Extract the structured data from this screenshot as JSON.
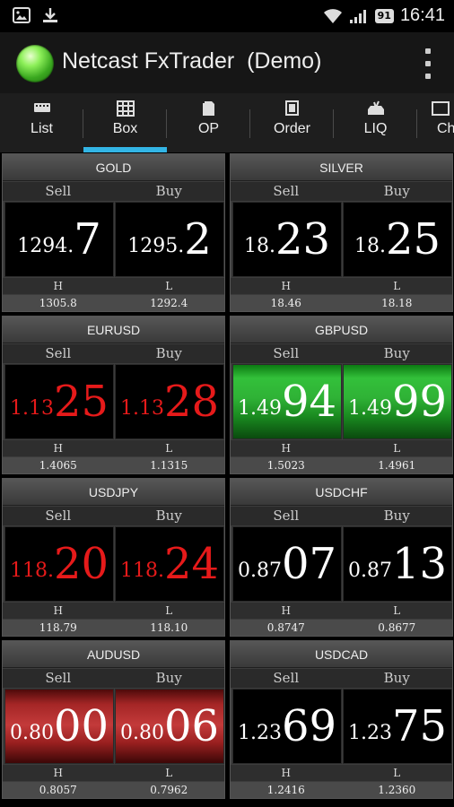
{
  "status_bar": {
    "time": "16:41",
    "battery": "91",
    "icons": [
      "image-icon",
      "download-icon",
      "wifi-icon",
      "signal-icon",
      "battery-icon"
    ]
  },
  "app": {
    "title": "Netcast FxTrader  (Demo)",
    "logo": "green-orb-logo",
    "overflow_icon": "more-vert-icon"
  },
  "tabs": [
    {
      "label": "List",
      "icon": "list-icon",
      "active": false
    },
    {
      "label": "Box",
      "icon": "grid-icon",
      "active": true
    },
    {
      "label": "OP",
      "icon": "document-icon",
      "active": false
    },
    {
      "label": "Order",
      "icon": "copy-icon",
      "active": false
    },
    {
      "label": "LIQ",
      "icon": "tray-icon",
      "active": false
    },
    {
      "label": "Ch",
      "icon": "chart-icon",
      "active": false
    }
  ],
  "colors": {
    "accent": "#33b5e5",
    "down": "#e61a1a",
    "up_bg": "#2fb236",
    "down_bg": "#c33a3a"
  },
  "quotes": [
    {
      "symbol": "GOLD",
      "sell_label": "Sell",
      "buy_label": "Buy",
      "sell": {
        "small": "1294.",
        "big": "7",
        "style": "white"
      },
      "buy": {
        "small": "1295.",
        "big": "2",
        "style": "white"
      },
      "hi_label": "H",
      "lo_label": "L",
      "high": "1305.8",
      "low": "1292.4"
    },
    {
      "symbol": "SILVER",
      "sell_label": "Sell",
      "buy_label": "Buy",
      "sell": {
        "small": "18.",
        "big": "23",
        "style": "white"
      },
      "buy": {
        "small": "18.",
        "big": "25",
        "style": "white"
      },
      "hi_label": "H",
      "lo_label": "L",
      "high": "18.46",
      "low": "18.18"
    },
    {
      "symbol": "EURUSD",
      "sell_label": "Sell",
      "buy_label": "Buy",
      "sell": {
        "small": "1.13",
        "big": "25",
        "style": "red"
      },
      "buy": {
        "small": "1.13",
        "big": "28",
        "style": "red"
      },
      "hi_label": "H",
      "lo_label": "L",
      "high": "1.4065",
      "low": "1.1315"
    },
    {
      "symbol": "GBPUSD",
      "sell_label": "Sell",
      "buy_label": "Buy",
      "sell": {
        "small": "1.49",
        "big": "94",
        "style": "green"
      },
      "buy": {
        "small": "1.49",
        "big": "99",
        "style": "green"
      },
      "hi_label": "H",
      "lo_label": "L",
      "high": "1.5023",
      "low": "1.4961"
    },
    {
      "symbol": "USDJPY",
      "sell_label": "Sell",
      "buy_label": "Buy",
      "sell": {
        "small": "118.",
        "big": "20",
        "style": "red"
      },
      "buy": {
        "small": "118.",
        "big": "24",
        "style": "red"
      },
      "hi_label": "H",
      "lo_label": "L",
      "high": "118.79",
      "low": "118.10"
    },
    {
      "symbol": "USDCHF",
      "sell_label": "Sell",
      "buy_label": "Buy",
      "sell": {
        "small": "0.87",
        "big": "07",
        "style": "white"
      },
      "buy": {
        "small": "0.87",
        "big": "13",
        "style": "white"
      },
      "hi_label": "H",
      "lo_label": "L",
      "high": "0.8747",
      "low": "0.8677"
    },
    {
      "symbol": "AUDUSD",
      "sell_label": "Sell",
      "buy_label": "Buy",
      "sell": {
        "small": "0.80",
        "big": "00",
        "style": "redbg"
      },
      "buy": {
        "small": "0.80",
        "big": "06",
        "style": "redbg"
      },
      "hi_label": "H",
      "lo_label": "L",
      "high": "0.8057",
      "low": "0.7962"
    },
    {
      "symbol": "USDCAD",
      "sell_label": "Sell",
      "buy_label": "Buy",
      "sell": {
        "small": "1.23",
        "big": "69",
        "style": "white"
      },
      "buy": {
        "small": "1.23",
        "big": "75",
        "style": "white"
      },
      "hi_label": "H",
      "lo_label": "L",
      "high": "1.2416",
      "low": "1.2360"
    }
  ]
}
